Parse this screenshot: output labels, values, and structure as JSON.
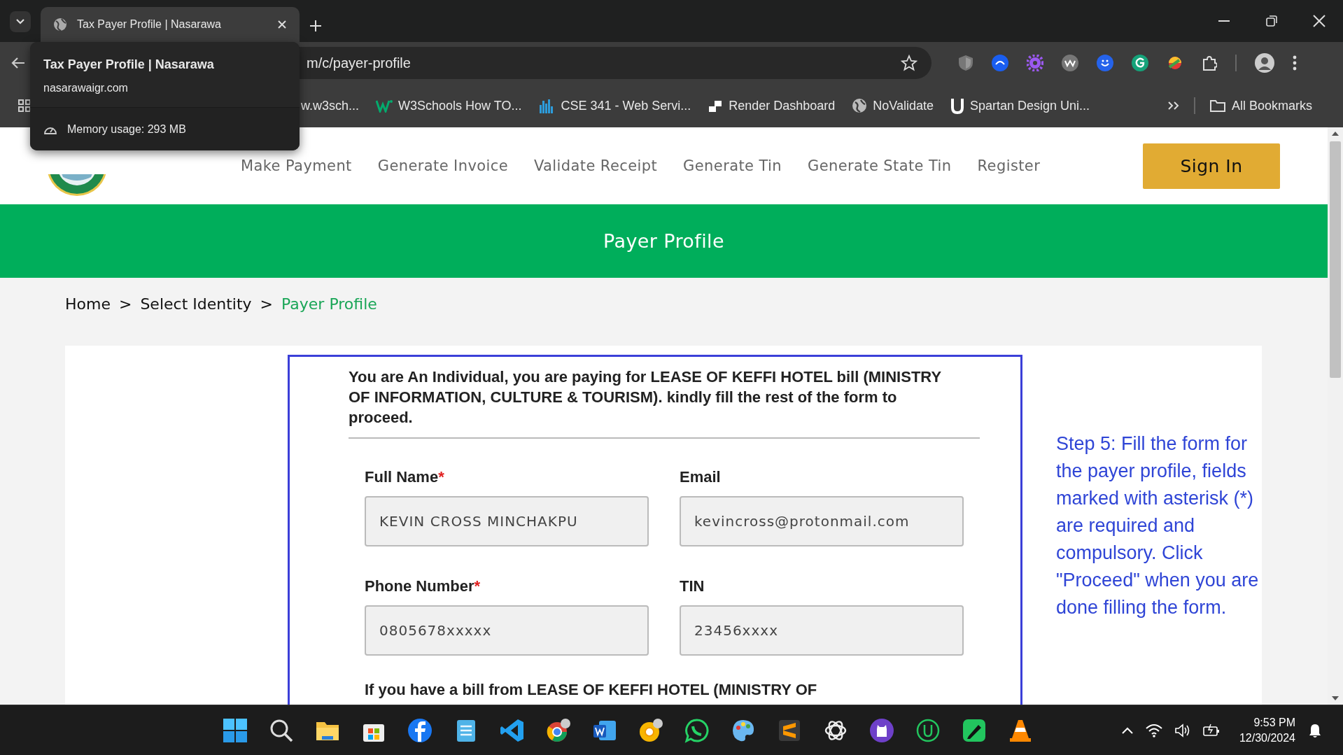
{
  "browser": {
    "tab_title": "Tax Payer Profile | Nasarawa",
    "tooltip": {
      "title": "Tax Payer Profile | Nasarawa",
      "domain": "nasarawaigr.com",
      "memory": "Memory usage: 293 MB"
    },
    "url": "m/c/payer-profile",
    "bookmarks": [
      {
        "kind": "plain",
        "label": "w.w3sch..."
      },
      {
        "kind": "w3",
        "label": "W3Schools How TO..."
      },
      {
        "kind": "chart",
        "label": "CSE 341 - Web Servi..."
      },
      {
        "kind": "render",
        "label": "Render Dashboard"
      },
      {
        "kind": "globe",
        "label": "NoValidate"
      },
      {
        "kind": "u",
        "label": "Spartan Design Uni..."
      }
    ],
    "all_bookmarks": "All Bookmarks"
  },
  "site": {
    "nav": [
      "Make Payment",
      "Generate Invoice",
      "Validate Receipt",
      "Generate Tin",
      "Generate State Tin",
      "Register"
    ],
    "sign_in": "Sign In",
    "banner": "Payer Profile",
    "breadcrumb": [
      {
        "label": "Home",
        "separator": ">",
        "current": false
      },
      {
        "label": "Select Identity",
        "separator": ">",
        "current": false
      },
      {
        "label": "Payer Profile",
        "current": true
      }
    ],
    "form": {
      "intro": "You are An Individual, you are paying for LEASE OF KEFFI HOTEL bill (MINISTRY OF INFORMATION, CULTURE & TOURISM). kindly fill the rest of the form to proceed.",
      "fields": [
        {
          "label": "Full Name",
          "required_mark": "*",
          "value": "KEVIN CROSS MINCHAKPU"
        },
        {
          "label": "Email",
          "value": "kevincross@protonmail.com"
        },
        {
          "label": "Phone Number",
          "required_mark": "*",
          "value": "0805678xxxxx"
        },
        {
          "label": "TIN",
          "value": "23456xxxx"
        }
      ],
      "note": "If you have a bill from LEASE OF KEFFI HOTEL (MINISTRY OF"
    },
    "help_text": "Step 5: Fill the form for the payer profile, fields marked with asterisk (*) are required and compulsory. Click \"Proceed\" when you are done filling the form."
  },
  "taskbar": {
    "time": "9:53 PM",
    "date": "12/30/2024"
  }
}
